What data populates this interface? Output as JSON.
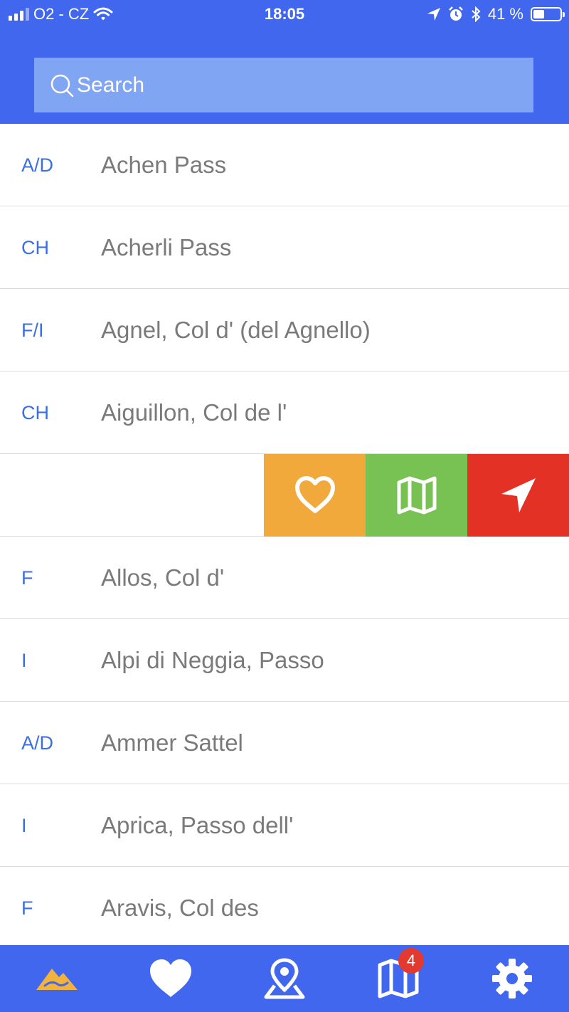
{
  "status_bar": {
    "carrier": "O2 - CZ",
    "time": "18:05",
    "battery": "41 %",
    "battery_level": 0.41
  },
  "search": {
    "placeholder": "Search"
  },
  "colors": {
    "primary": "#4067ee",
    "search_bg": "#80a5f2",
    "code_text": "#3d6fe0",
    "name_text": "#7a7a7a",
    "favorite_action": "#f2a93b",
    "map_action": "#78c153",
    "navigate_action": "#e33125",
    "badge": "#e23a2f",
    "tab_active_icon": "#f2b33d"
  },
  "passes": [
    {
      "code": "A/D",
      "name": "Achen Pass"
    },
    {
      "code": "CH",
      "name": "Acherli Pass"
    },
    {
      "code": "F/I",
      "name": "Agnel, Col d' (del Agnello)"
    },
    {
      "code": "CH",
      "name": "Aiguillon, Col de l'"
    },
    {
      "code": "",
      "name": ""
    },
    {
      "code": "F",
      "name": "Allos, Col d'"
    },
    {
      "code": "I",
      "name": "Alpi di Neggia, Passo"
    },
    {
      "code": "A/D",
      "name": "Ammer Sattel"
    },
    {
      "code": "I",
      "name": "Aprica, Passo dell'"
    },
    {
      "code": "F",
      "name": "Aravis, Col des"
    }
  ],
  "swipe_actions": [
    {
      "icon": "heart-outline-icon"
    },
    {
      "icon": "map-icon"
    },
    {
      "icon": "navigation-arrow-icon"
    }
  ],
  "tab_bar": {
    "tabs": [
      {
        "icon": "mountain-pass-icon",
        "active": true
      },
      {
        "icon": "heart-icon",
        "active": false
      },
      {
        "icon": "location-pin-icon",
        "active": false
      },
      {
        "icon": "map-icon",
        "active": false
      },
      {
        "icon": "gear-icon",
        "active": false
      }
    ],
    "map_badge": "4"
  }
}
